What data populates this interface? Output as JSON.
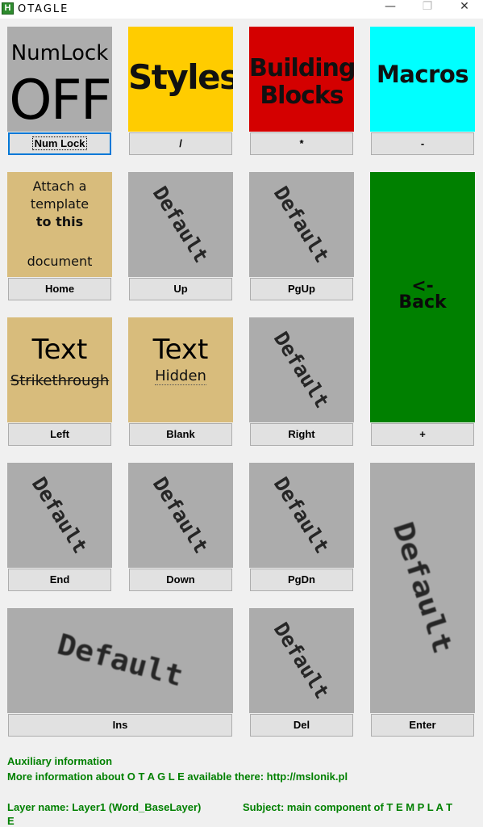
{
  "window": {
    "title": "OTAGLE",
    "app_icon_letter": "H",
    "minimize_glyph": "—",
    "maximize_glyph": "❐",
    "close_glyph": "✕"
  },
  "tiles": {
    "numlock": {
      "line1": "NumLock",
      "line2": "OFF",
      "color": "#acacac"
    },
    "styles": {
      "label": "Styles",
      "color": "#ffcc00"
    },
    "building_blocks": {
      "line1": "Building",
      "line2": "Blocks",
      "color": "#d40000"
    },
    "macros": {
      "label": "Macros",
      "color": "#00ffff"
    },
    "attach": {
      "line1": "Attach a",
      "line2": "template",
      "line3": "to this",
      "line4": "document",
      "color": "#d8bc7c"
    },
    "default_label": "Default",
    "text_strike": {
      "line1": "Text",
      "line2": "Strikethrough",
      "color": "#d8bc7c"
    },
    "text_hidden": {
      "line1": "Text",
      "line2": "Hidden",
      "color": "#d8bc7c"
    },
    "back": {
      "line1": "<-",
      "line2": "Back",
      "color": "#008000"
    }
  },
  "keys": {
    "numlock": "Num Lock",
    "divide": "/",
    "multiply": "*",
    "minus": "-",
    "home": "Home",
    "up": "Up",
    "pgup": "PgUp",
    "left": "Left",
    "blank": "Blank",
    "right": "Right",
    "plus": "+",
    "end": "End",
    "down": "Down",
    "pgdn": "PgDn",
    "ins": "Ins",
    "del": "Del",
    "enter": "Enter"
  },
  "info": {
    "heading": "Auxiliary information",
    "more": "More information about O T A G L E available there: http://mslonik.pl",
    "layer": "Layer name: Layer1 (Word_BaseLayer)",
    "subject": "Subject: main component of T E M P L A T",
    "subject_wrap": "E",
    "text_color": "#008000"
  }
}
